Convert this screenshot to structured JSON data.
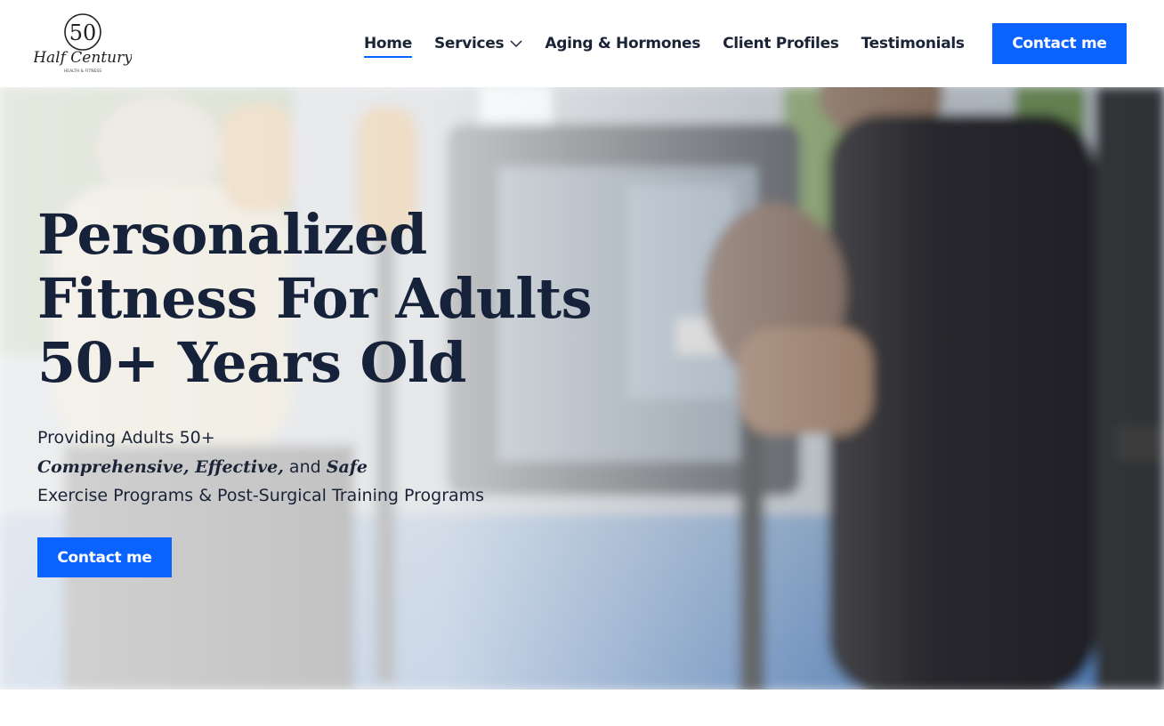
{
  "brand": {
    "logo_icon": "half-century-logo",
    "logo_number": "50",
    "logo_script": "Half Century",
    "logo_tagline": "HEALTH & FITNESS"
  },
  "nav": {
    "items": [
      {
        "label": "Home",
        "active": true
      },
      {
        "label": "Services",
        "has_dropdown": true
      },
      {
        "label": "Aging & Hormones"
      },
      {
        "label": "Client Profiles"
      },
      {
        "label": "Testimonials"
      }
    ],
    "cta": "Contact me"
  },
  "hero": {
    "title": "Personalized Fitness For Adults 50+ Years Old",
    "line1": "Providing Adults 50+",
    "line2_em1": "Comprehensive, Effective,",
    "line2_and": "and",
    "line2_em2": "Safe",
    "line3": "Exercise Programs & Post-Surgical Training Programs",
    "cta": "Contact me"
  },
  "colors": {
    "accent": "#0b63ff",
    "heading": "#16213a",
    "text": "#1b2437"
  }
}
